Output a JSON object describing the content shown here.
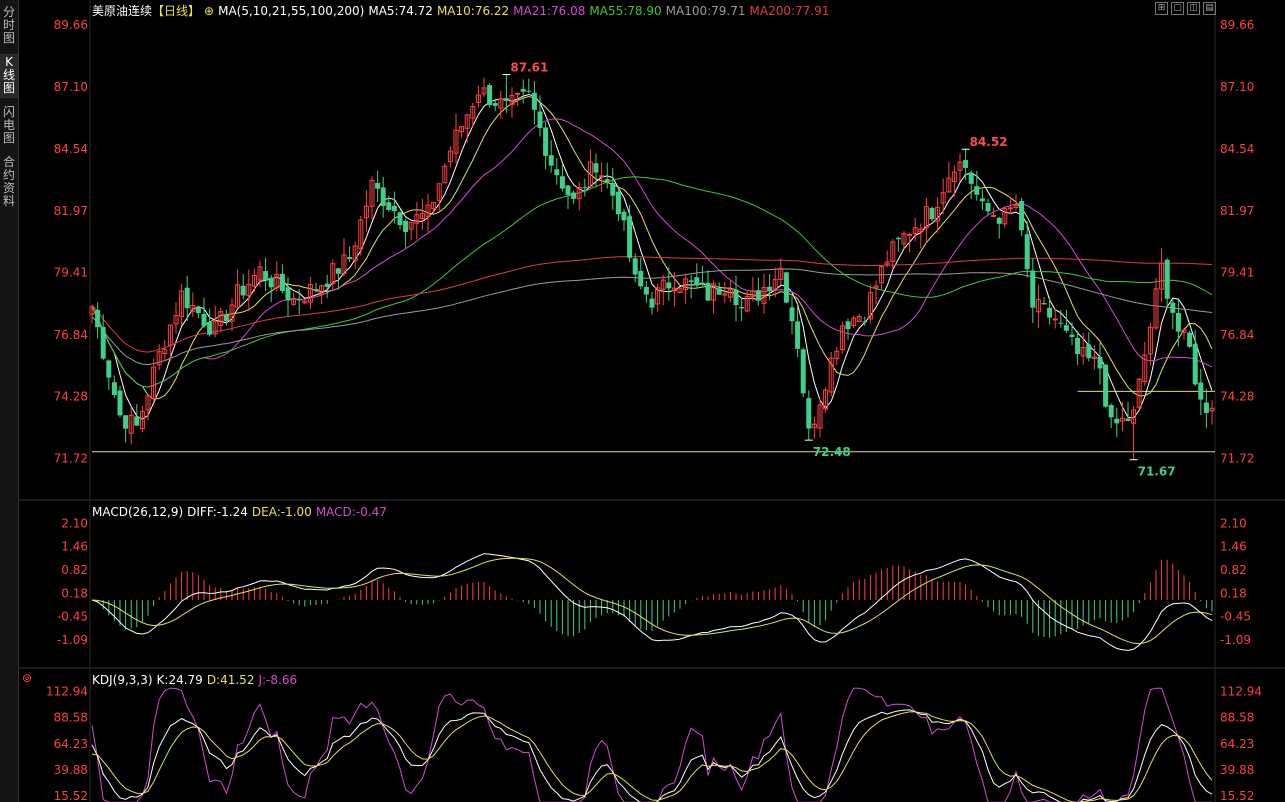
{
  "tabs": [
    {
      "label": "分时图"
    },
    {
      "label": "K线图"
    },
    {
      "label": "闪电图"
    },
    {
      "label": "合约资料"
    }
  ],
  "toolbar": {
    "icons": [
      "grid-icon",
      "window-icon",
      "layout-icon",
      "panel-icon"
    ]
  },
  "price_panel": {
    "symbol": "美原油连续",
    "period": "【日线】",
    "settings_icon": "gear-icon",
    "ma_label": "MA(5,10,21,55,100,200)",
    "ma_values": [
      {
        "label": "MA5:74.72",
        "color": "#ffffff"
      },
      {
        "label": "MA10:76.22",
        "color": "#e8e24a"
      },
      {
        "label": "MA21:76.08",
        "color": "#d24cd2"
      },
      {
        "label": "MA55:78.90",
        "color": "#3cc83c"
      },
      {
        "label": "MA100:79.71",
        "color": "#9a9a9a"
      },
      {
        "label": "MA200:77.91",
        "color": "#e03c3c"
      }
    ]
  },
  "macd_panel": {
    "label": "MACD(26,12,9)",
    "values": [
      {
        "label": "DIFF:-1.24",
        "color": "#ffffff"
      },
      {
        "label": "DEA:-1.00",
        "color": "#e8e24a"
      },
      {
        "label": "MACD:-0.47",
        "color": "#d24cd2"
      }
    ]
  },
  "kdj_panel": {
    "icon": "target-icon",
    "label": "KDJ(9,3,3)",
    "values": [
      {
        "label": "K:24.79",
        "color": "#ffffff"
      },
      {
        "label": "D:41.52",
        "color": "#e8e24a"
      },
      {
        "label": "J:-8.66",
        "color": "#d24cd2"
      }
    ]
  },
  "chart_data": [
    {
      "type": "candlestick",
      "ylim": [
        70.5,
        90.2
      ],
      "yticks": [
        "89.66",
        "87.10",
        "84.54",
        "81.97",
        "79.41",
        "76.84",
        "74.28",
        "71.72"
      ],
      "colors": {
        "up": "#ff4040",
        "down": "#3ed08a"
      },
      "annotations": [
        {
          "text": "87.61",
          "index": 74,
          "value": 87.61,
          "color": "#ff4b4b"
        },
        {
          "text": "84.52",
          "index": 156,
          "value": 84.52,
          "color": "#ff4b4b"
        },
        {
          "text": "72.48",
          "index": 128,
          "value": 72.48,
          "color": "#3ed08a"
        },
        {
          "text": "71.67",
          "index": 186,
          "value": 71.67,
          "color": "#3ed08a"
        }
      ],
      "hlines": [
        {
          "value": 72.0,
          "color": "#e8e24a"
        },
        {
          "value": 74.5,
          "from_index": 176,
          "color": "#e8e24a"
        }
      ],
      "anchors": [
        [
          0,
          78.0
        ],
        [
          5,
          73.5
        ],
        [
          8,
          73.0
        ],
        [
          12,
          76.0
        ],
        [
          16,
          78.5
        ],
        [
          22,
          77.0
        ],
        [
          26,
          78.5
        ],
        [
          30,
          79.5
        ],
        [
          36,
          78.3
        ],
        [
          40,
          78.8
        ],
        [
          46,
          80.0
        ],
        [
          50,
          83.0
        ],
        [
          56,
          81.5
        ],
        [
          60,
          81.8
        ],
        [
          64,
          84.5
        ],
        [
          69,
          87.0
        ],
        [
          74,
          86.2
        ],
        [
          78,
          86.7
        ],
        [
          82,
          84.0
        ],
        [
          86,
          82.3
        ],
        [
          90,
          84.0
        ],
        [
          94,
          82.2
        ],
        [
          97,
          79.0
        ],
        [
          100,
          78.3
        ],
        [
          104,
          79.2
        ],
        [
          110,
          78.5
        ],
        [
          114,
          79.1
        ],
        [
          116,
          77.9
        ],
        [
          120,
          78.8
        ],
        [
          123,
          79.6
        ],
        [
          126,
          76.5
        ],
        [
          128,
          72.7
        ],
        [
          131,
          75.0
        ],
        [
          134,
          77.3
        ],
        [
          138,
          77.8
        ],
        [
          142,
          80.0
        ],
        [
          146,
          81.2
        ],
        [
          150,
          82.0
        ],
        [
          154,
          84.0
        ],
        [
          156,
          83.8
        ],
        [
          159,
          82.0
        ],
        [
          163,
          81.7
        ],
        [
          165,
          82.2
        ],
        [
          168,
          78.0
        ],
        [
          172,
          77.5
        ],
        [
          176,
          76.0
        ],
        [
          180,
          75.5
        ],
        [
          182,
          73.0
        ],
        [
          186,
          73.5
        ],
        [
          188,
          76.0
        ],
        [
          191,
          79.6
        ],
        [
          194,
          77.0
        ],
        [
          196,
          76.2
        ],
        [
          198,
          74.0
        ],
        [
          200,
          73.8
        ]
      ],
      "ma_series": [
        {
          "name": "MA5",
          "color": "#ffffff",
          "period": 5
        },
        {
          "name": "MA10",
          "color": "#e8e24a",
          "period": 10
        },
        {
          "name": "MA21",
          "color": "#d24cd2",
          "period": 21
        },
        {
          "name": "MA55",
          "color": "#3cc83c",
          "period": 55
        },
        {
          "name": "MA100",
          "color": "#9a9a9a",
          "period": 100
        },
        {
          "name": "MA200",
          "color": "#e03c3c",
          "period": 200
        }
      ]
    },
    {
      "type": "bar",
      "ylim": [
        -1.75,
        2.3
      ],
      "yticks": [
        "2.10",
        "1.46",
        "0.82",
        "0.18",
        "-0.45",
        "-1.09"
      ],
      "series": [
        {
          "name": "DIFF",
          "color": "#ffffff"
        },
        {
          "name": "DEA",
          "color": "#e8e24a"
        },
        {
          "name": "MACD",
          "color": "#d24cd2"
        }
      ]
    },
    {
      "type": "line",
      "ylim": [
        12,
        118
      ],
      "yticks": [
        "112.94",
        "88.58",
        "64.23",
        "39.88",
        "15.52"
      ],
      "series": [
        {
          "name": "K",
          "color": "#ffffff"
        },
        {
          "name": "D",
          "color": "#e8e24a"
        },
        {
          "name": "J",
          "color": "#d24cd2"
        }
      ]
    }
  ]
}
